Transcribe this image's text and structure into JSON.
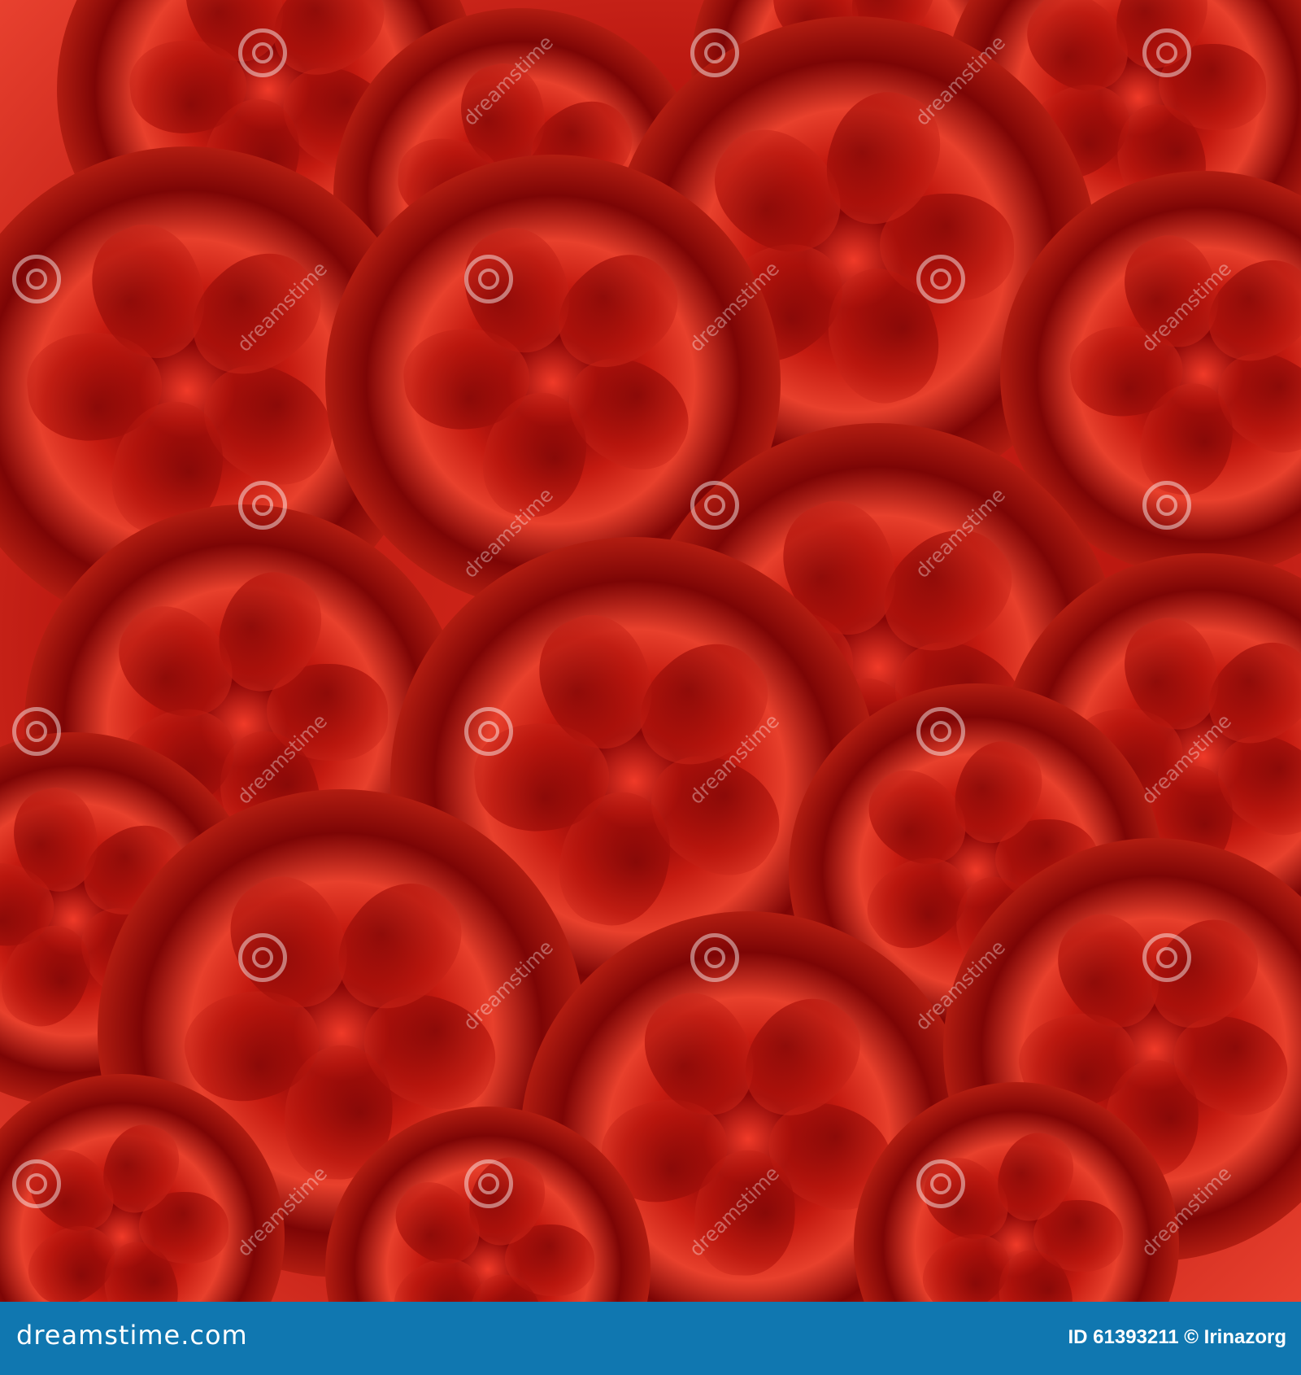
{
  "image": {
    "subject": "red roses pattern",
    "colors": {
      "dark": "#7a0505",
      "mid": "#c81c12",
      "light": "#f0503a"
    }
  },
  "watermark": {
    "text": "dreamstime"
  },
  "footer": {
    "brand": "dreamstime.com",
    "credit": "ID 61393211 © Irinazorg",
    "background": "#1077b0"
  }
}
